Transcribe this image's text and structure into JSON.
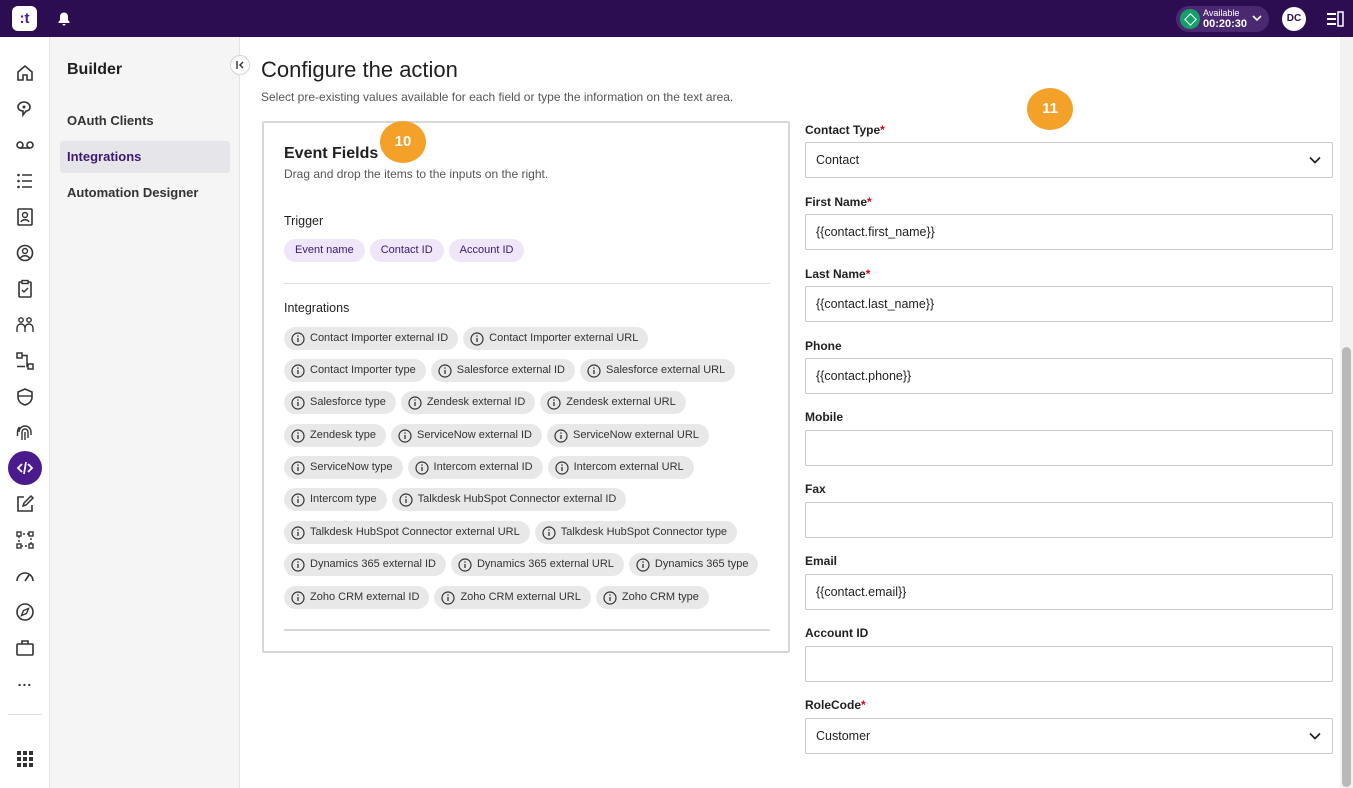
{
  "topbar": {
    "logo": ":t",
    "status_label": "Available",
    "status_time": "00:20:30",
    "avatar": "DC",
    "colors": {
      "background": "#2c0d52",
      "status": "#15a06a"
    }
  },
  "rail": {
    "icons": [
      "home-icon",
      "voice-bubble-icon",
      "voicemail-icon",
      "list-icon",
      "contacts-icon",
      "agent-icon",
      "clipboard-icon",
      "team-icon",
      "flow-icon",
      "shield-icon",
      "fingerprint-icon",
      "code-icon",
      "edit-icon",
      "frame-icon",
      "dashboard-icon",
      "compass-icon",
      "briefcase-icon"
    ],
    "active": "code-icon",
    "more": "...",
    "apps": "apps-grid-icon"
  },
  "menu": {
    "title": "Builder",
    "items": [
      {
        "label": "OAuth Clients",
        "active": false
      },
      {
        "label": "Integrations",
        "active": true
      },
      {
        "label": "Automation Designer",
        "active": false
      }
    ]
  },
  "main": {
    "title": "Configure the action",
    "subtitle": "Select pre-existing values available for each field or type the information on the text area."
  },
  "event_fields": {
    "title": "Event Fields",
    "subtitle": "Drag and drop the items to the inputs on the right.",
    "trigger_label": "Trigger",
    "trigger_chips": [
      "Event name",
      "Contact ID",
      "Account ID"
    ],
    "integrations_label": "Integrations",
    "integration_rows": [
      [
        "Contact Importer external ID",
        "Contact Importer external URL"
      ],
      [
        "Contact Importer type",
        "Salesforce external ID",
        "Salesforce external URL"
      ],
      [
        "Salesforce type",
        "Zendesk external ID",
        "Zendesk external URL"
      ],
      [
        "Zendesk type",
        "ServiceNow external ID",
        "ServiceNow external URL"
      ],
      [
        "ServiceNow type",
        "Intercom external ID",
        "Intercom external URL"
      ],
      [
        "Intercom type",
        "Talkdesk HubSpot Connector external ID"
      ],
      [
        "Talkdesk HubSpot Connector external URL",
        "Talkdesk HubSpot Connector type"
      ],
      [
        "Dynamics 365 external ID",
        "Dynamics 365 external URL",
        "Dynamics 365 type"
      ],
      [
        "Zoho CRM external ID",
        "Zoho CRM external URL",
        "Zoho CRM type"
      ]
    ]
  },
  "badges": {
    "left": "10",
    "right": "11",
    "color": "#f4a12a"
  },
  "form": {
    "contact_type": {
      "label": "Contact Type",
      "required": "*",
      "value": "Contact"
    },
    "first_name": {
      "label": "First Name",
      "required": "*",
      "value": "{{contact.first_name}}"
    },
    "last_name": {
      "label": "Last Name",
      "required": "*",
      "value": "{{contact.last_name}}"
    },
    "phone": {
      "label": "Phone",
      "value": "{{contact.phone}}"
    },
    "mobile": {
      "label": "Mobile",
      "value": ""
    },
    "fax": {
      "label": "Fax",
      "value": ""
    },
    "email": {
      "label": "Email",
      "value": "{{contact.email}}"
    },
    "account_id": {
      "label": "Account ID",
      "value": ""
    },
    "role_code": {
      "label": "RoleCode",
      "required": "*",
      "value": "Customer"
    }
  }
}
